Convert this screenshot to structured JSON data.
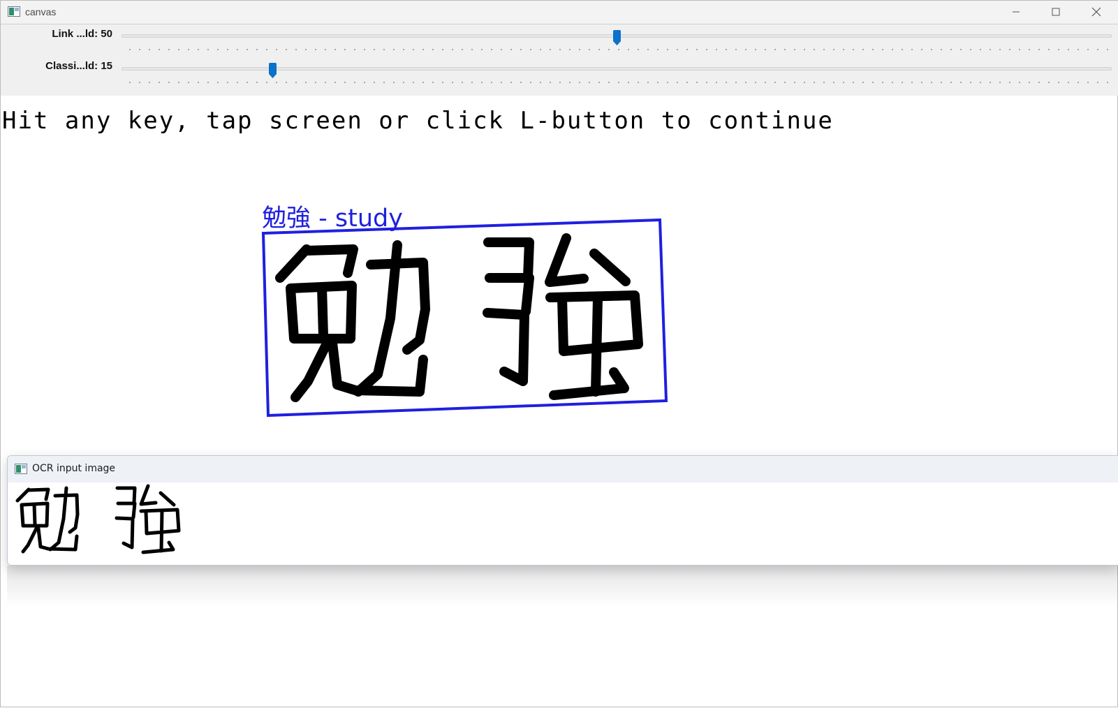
{
  "window": {
    "title": "canvas",
    "controls": {
      "minimize": "minimize-icon",
      "maximize": "maximize-icon",
      "close": "close-icon"
    }
  },
  "trackbars": [
    {
      "label": "Link ...ld: 50",
      "value": 50,
      "max": 100
    },
    {
      "label": "Classi...ld: 15",
      "value": 15,
      "max": 100
    }
  ],
  "canvas": {
    "hint": "Hit any key, tap screen or click L-button to continue",
    "detection_label": "勉強 - study",
    "recognized_text": "勉強",
    "box_color": "#1f1fe0"
  },
  "ocr_window": {
    "title": "OCR input image"
  },
  "colors": {
    "accent": "#0a72c9",
    "box": "#1f1fe0",
    "ink": "#000000"
  }
}
